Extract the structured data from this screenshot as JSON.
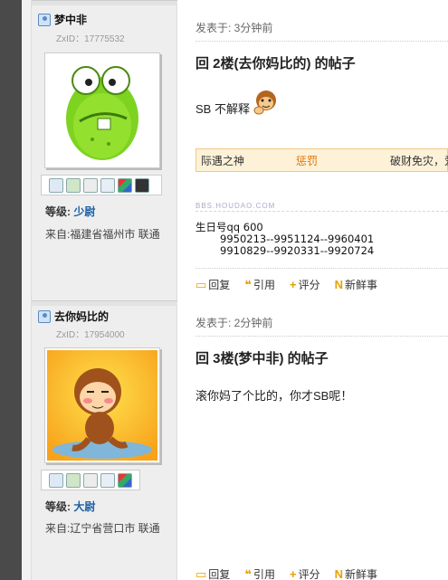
{
  "posts": [
    {
      "username": "梦中非",
      "zxid": "ZxID：17775532",
      "avatar": "green-frog",
      "grade_label": "等级:",
      "grade_value": "少尉",
      "from": "来自:福建省福州市 联通",
      "posted_time": "发表于: 3分钟前",
      "title": "回 2楼(去你妈比的) 的帖子",
      "body": "SB 不解释",
      "body_emoticon": "monkey-emoticon",
      "banner": {
        "left": "际遇之神",
        "middle": "惩罚",
        "right": "破财免灾，爱"
      },
      "sig_tag": "BBS.HOUDAO.COM",
      "signature": [
        "生日号qq 600",
        "9950213--9951124--9960401",
        "9910829--9920331--9920724"
      ],
      "actions": [
        "回复",
        "引用",
        "评分",
        "新鲜事"
      ]
    },
    {
      "username": "去你妈比的",
      "zxid": "ZxID：17954000",
      "avatar": "monkey",
      "grade_label": "等级:",
      "grade_value": "大尉",
      "from": "来自:辽宁省营口市 联通",
      "posted_time": "发表于: 2分钟前",
      "title": "回 3楼(梦中非) 的帖子",
      "body": "滚你妈了个比的，你才SB呢！",
      "actions": [
        "回复",
        "引用",
        "评分",
        "新鲜事"
      ]
    }
  ],
  "colors": {
    "accent": "#1a5fa8",
    "banner_bg": "#fdf2d8",
    "banner_warn": "#e07000"
  }
}
